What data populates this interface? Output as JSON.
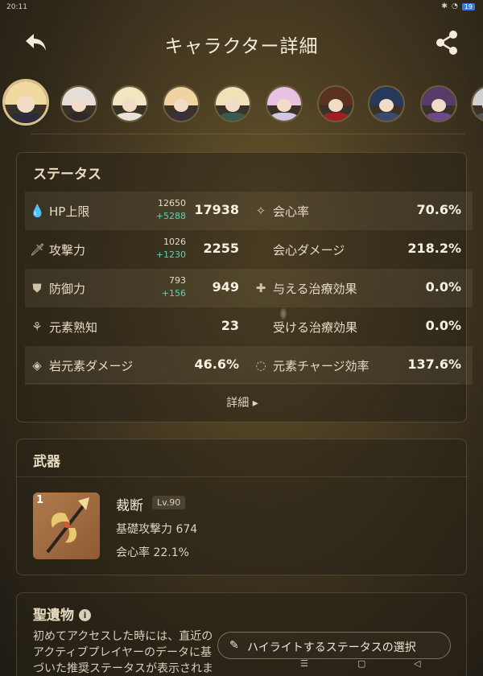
{
  "statusbar": {
    "time": "20:11",
    "battery": "19"
  },
  "header": {
    "title": "キャラクター詳細"
  },
  "avatars": [
    {
      "hair": "#f1d9a0",
      "body": "#2c2c3c",
      "accent": "#1e1e2a"
    },
    {
      "hair": "#e4ddd8",
      "body": "#2e2a2a",
      "accent": "#b33"
    },
    {
      "hair": "#f0e6c0",
      "body": "#e8e2d8",
      "accent": "#fff"
    },
    {
      "hair": "#f0d3a0",
      "body": "#3b2f3d",
      "accent": "#7a3"
    },
    {
      "hair": "#f1e0b8",
      "body": "#3a5a50",
      "accent": "#fff"
    },
    {
      "hair": "#e8c0e0",
      "body": "#d0c8e0",
      "accent": "#fff"
    },
    {
      "hair": "#5a3020",
      "body": "#a02020",
      "accent": "#f44"
    },
    {
      "hair": "#28385a",
      "body": "#3a4a6a",
      "accent": "#345"
    },
    {
      "hair": "#5a3a6a",
      "body": "#6a4a8a",
      "accent": "#fff"
    },
    {
      "hair": "#d0d0d0",
      "body": "#555",
      "accent": "#fff"
    }
  ],
  "status": {
    "title": "ステータス",
    "rows": [
      {
        "left": {
          "icon": "hp-icon",
          "glyph": "💧",
          "label": "HP上限",
          "base": "12650",
          "bonus": "+5288",
          "value": "17938"
        },
        "right": {
          "icon": "crit-rate-icon",
          "glyph": "✧",
          "label": "会心率",
          "value": "70.6%"
        }
      },
      {
        "left": {
          "icon": "atk-icon",
          "glyph": "🗡",
          "label": "攻撃力",
          "base": "1026",
          "bonus": "+1230",
          "value": "2255"
        },
        "right": {
          "icon": "",
          "glyph": "",
          "label": "会心ダメージ",
          "value": "218.2%"
        }
      },
      {
        "left": {
          "icon": "def-icon",
          "glyph": "⛊",
          "label": "防御力",
          "base": "793",
          "bonus": "+156",
          "value": "949"
        },
        "right": {
          "icon": "healing-bonus-icon",
          "glyph": "✚",
          "label": "与える治療効果",
          "value": "0.0%"
        }
      },
      {
        "left": {
          "icon": "elemental-mastery-icon",
          "glyph": "⚘",
          "label": "元素熟知",
          "value": "23"
        },
        "right": {
          "icon": "",
          "glyph": "",
          "label": "受ける治療効果",
          "value": "0.0%"
        }
      },
      {
        "left": {
          "icon": "geo-dmg-icon",
          "glyph": "◈",
          "label": "岩元素ダメージ",
          "value": "46.6%"
        },
        "right": {
          "icon": "energy-recharge-icon",
          "glyph": "◌",
          "label": "元素チャージ効率",
          "value": "137.6%"
        }
      }
    ],
    "detail_label": "詳細 ▸"
  },
  "weapon": {
    "title": "武器",
    "refinement": "1",
    "name": "裁断",
    "level": "Lv.90",
    "base_atk": "基礎攻撃力 674",
    "substat": "会心率 22.1%"
  },
  "artifact": {
    "title": "聖遺物",
    "info_glyph": "i",
    "description": "初めてアクセスした時には、直近のアクティブプレイヤーのデータに基づいた推奨ステータスが表示されます。",
    "highlight_button": "ハイライトするステータスの選択"
  },
  "navbar": {
    "recents": "☰",
    "home": "▢",
    "back": "◁"
  }
}
